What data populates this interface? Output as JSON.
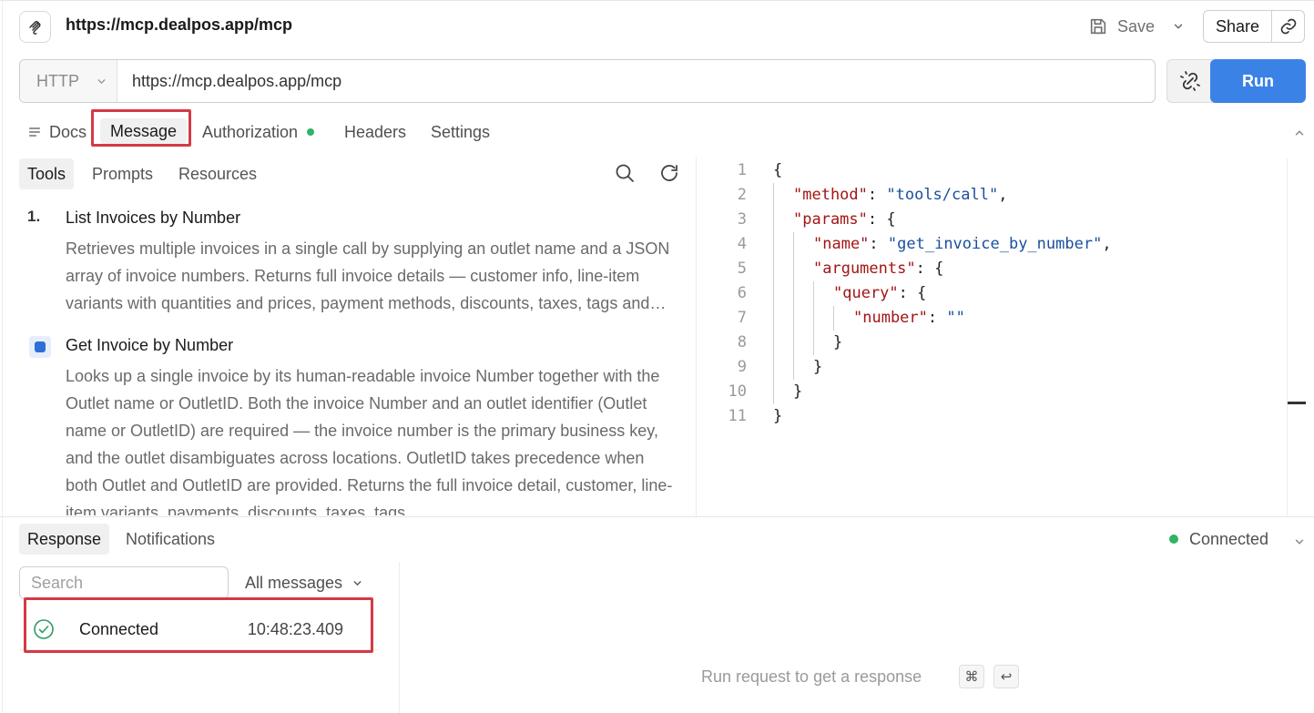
{
  "header": {
    "title": "https://mcp.dealpos.app/mcp",
    "save_label": "Save",
    "share_label": "Share"
  },
  "request": {
    "method": "HTTP",
    "url": "https://mcp.dealpos.app/mcp",
    "run_label": "Run"
  },
  "request_tabs": {
    "docs": "Docs",
    "message": "Message",
    "authorization": "Authorization",
    "headers": "Headers",
    "settings": "Settings",
    "active": "Message"
  },
  "sidebar_tabs": {
    "tools": "Tools",
    "prompts": "Prompts",
    "resources": "Resources",
    "active": "Tools"
  },
  "tools": [
    {
      "marker": "1.",
      "name": "List Invoices by Number",
      "description": "Retrieves multiple invoices in a single call by supplying an outlet name and a JSON array of invoice numbers. Returns full invoice details — customer info, line-item variants with quantities and prices, payment methods, discounts, taxes, tags and more."
    },
    {
      "marker": "selected",
      "name": "Get Invoice by Number",
      "description": "Looks up a single invoice by its human-readable invoice Number together with the Outlet name or OutletID. Both the invoice Number and an outlet identifier (Outlet name or OutletID) are required — the invoice number is the primary business key, and the outlet disambiguates across locations. OutletID takes precedence when both Outlet and OutletID are provided. Returns the full invoice detail, customer, line-item variants, payments, discounts, taxes, tags"
    }
  ],
  "editor": {
    "lines": [
      {
        "n": "1",
        "indent": 0,
        "parts": [
          {
            "t": "p",
            "v": "{"
          }
        ]
      },
      {
        "n": "2",
        "indent": 1,
        "parts": [
          {
            "t": "k",
            "v": "\"method\""
          },
          {
            "t": "p",
            "v": ": "
          },
          {
            "t": "s",
            "v": "\"tools/call\""
          },
          {
            "t": "p",
            "v": ","
          }
        ]
      },
      {
        "n": "3",
        "indent": 1,
        "parts": [
          {
            "t": "k",
            "v": "\"params\""
          },
          {
            "t": "p",
            "v": ": {"
          }
        ]
      },
      {
        "n": "4",
        "indent": 2,
        "parts": [
          {
            "t": "k",
            "v": "\"name\""
          },
          {
            "t": "p",
            "v": ": "
          },
          {
            "t": "s",
            "v": "\"get_invoice_by_number\""
          },
          {
            "t": "p",
            "v": ","
          }
        ]
      },
      {
        "n": "5",
        "indent": 2,
        "parts": [
          {
            "t": "k",
            "v": "\"arguments\""
          },
          {
            "t": "p",
            "v": ": {"
          }
        ]
      },
      {
        "n": "6",
        "indent": 3,
        "parts": [
          {
            "t": "k",
            "v": "\"query\""
          },
          {
            "t": "p",
            "v": ": {"
          }
        ]
      },
      {
        "n": "7",
        "indent": 4,
        "parts": [
          {
            "t": "k",
            "v": "\"number\""
          },
          {
            "t": "p",
            "v": ": "
          },
          {
            "t": "s",
            "v": "\"\""
          }
        ]
      },
      {
        "n": "8",
        "indent": 3,
        "parts": [
          {
            "t": "p",
            "v": "}"
          }
        ]
      },
      {
        "n": "9",
        "indent": 2,
        "parts": [
          {
            "t": "p",
            "v": "}"
          }
        ]
      },
      {
        "n": "10",
        "indent": 1,
        "parts": [
          {
            "t": "p",
            "v": "}"
          }
        ]
      },
      {
        "n": "11",
        "indent": 0,
        "parts": [
          {
            "t": "p",
            "v": "}"
          }
        ]
      }
    ]
  },
  "response": {
    "tabs": {
      "response": "Response",
      "notifications": "Notifications",
      "active": "Response"
    },
    "connection_status": "Connected",
    "search_placeholder": "Search",
    "filter_label": "All messages",
    "log": [
      {
        "status": "Connected",
        "time": "10:48:23.409"
      }
    ],
    "empty_message": "Run request to get a response",
    "shortcut_keys": [
      "⌘",
      "↩"
    ]
  },
  "colors": {
    "accent": "#3b82e6",
    "connected": "#2fb366",
    "highlight": "#d43a46",
    "json_key": "#a31515",
    "json_string": "#1b4f9c"
  }
}
